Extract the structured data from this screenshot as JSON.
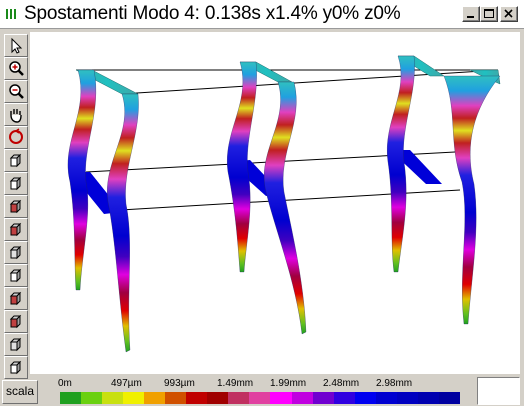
{
  "window": {
    "title": "Spostamenti Modo 4: 0.138s x1.4% y0% z0%"
  },
  "toolbar": {
    "tools": [
      {
        "icon": "pointer-arrow-icon"
      },
      {
        "icon": "zoom-in-icon"
      },
      {
        "icon": "zoom-out-icon"
      },
      {
        "icon": "pan-hand-icon"
      },
      {
        "icon": "rotate-icon"
      },
      {
        "icon": "view-cube-front-icon"
      },
      {
        "icon": "view-cube-side-icon"
      },
      {
        "icon": "view-cube-top-icon"
      },
      {
        "icon": "view-cube-red-left-icon"
      },
      {
        "icon": "view-cube-red-right-icon"
      },
      {
        "icon": "view-cube-iso-icon"
      },
      {
        "icon": "view-cube-iso-2-icon"
      },
      {
        "icon": "view-cube-iso-3-icon"
      },
      {
        "icon": "view-cube-iso-4-icon"
      },
      {
        "icon": "view-cube-iso-5-icon"
      }
    ]
  },
  "legend": {
    "button_label": "scala",
    "ticks": [
      "0m",
      "497µm",
      "993µm",
      "1.49mm",
      "1.99mm",
      "2.48mm",
      "2.98mm"
    ],
    "colors": [
      "#20a020",
      "#6ad010",
      "#c8e010",
      "#f0f000",
      "#f0a000",
      "#d05000",
      "#c00000",
      "#a00000",
      "#c03060",
      "#e040a0",
      "#ff00ff",
      "#c000e0",
      "#7000d0",
      "#3000e0",
      "#0000f0",
      "#0000d0",
      "#0000c0",
      "#0000b0",
      "#0000a0"
    ]
  },
  "structure_colors": {
    "beam": "#40b8b0",
    "column_top": "#30b8b8",
    "column_mid": "#0000d8",
    "column_bottom": "#20c000"
  }
}
